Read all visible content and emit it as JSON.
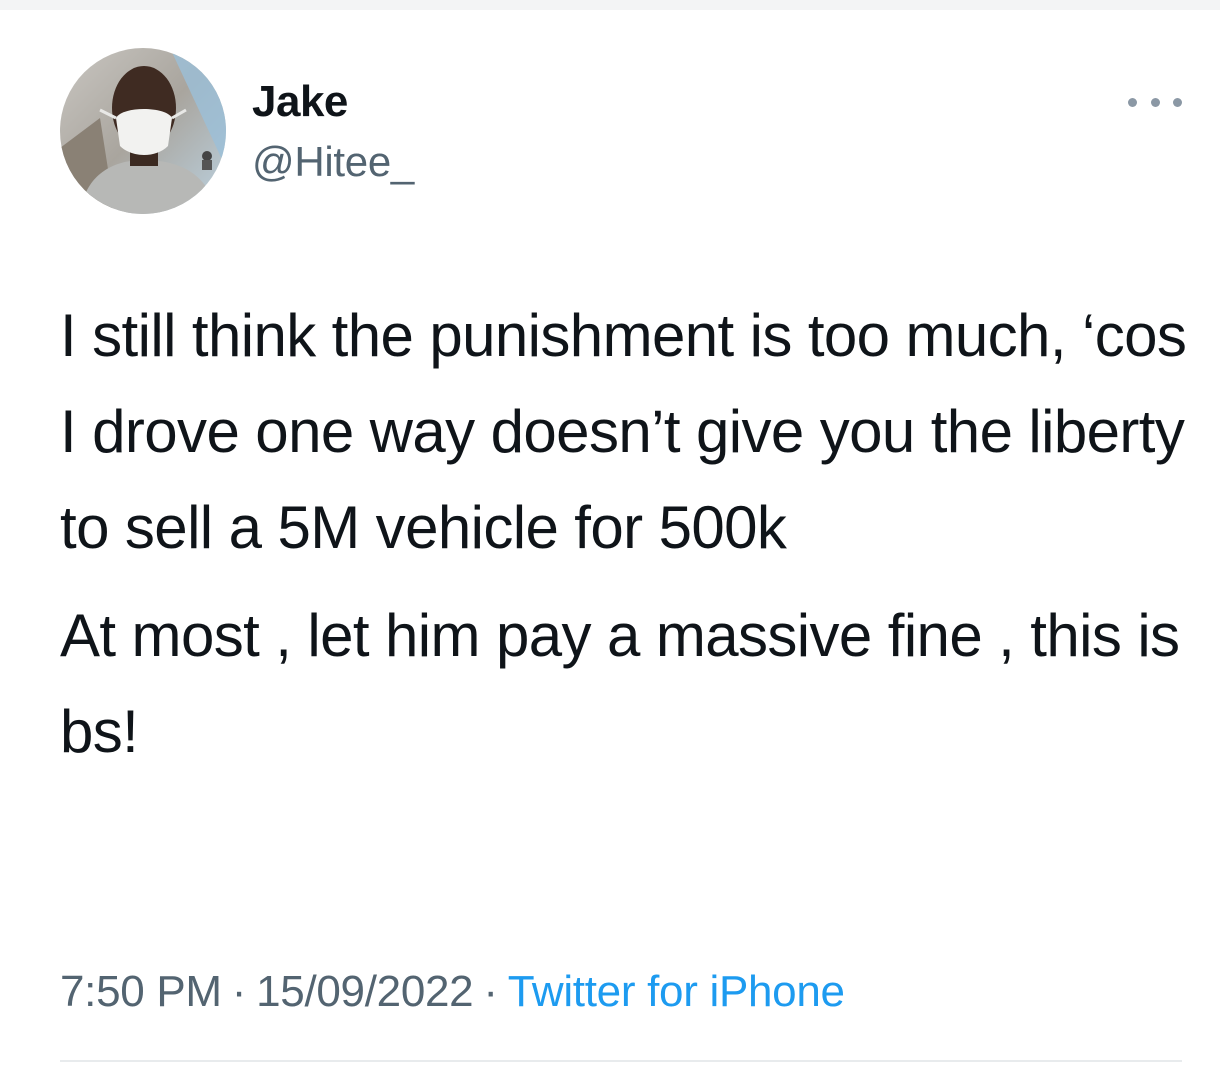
{
  "author": {
    "name": "Jake",
    "handle": "@Hitee_"
  },
  "tweet": {
    "paragraphs": [
      "I still think the punishment is too much, ‘cos I drove one way doesn’t give you the liberty to sell a 5M vehicle for 500k",
      "At most , let him pay a massive fine , this is bs!"
    ]
  },
  "meta": {
    "time": "7:50 PM",
    "separator": "·",
    "date": "15/09/2022",
    "source": "Twitter for iPhone"
  },
  "icons": {
    "more": "more-options-icon",
    "avatar": "profile-photo"
  },
  "colors": {
    "text": "#0f1419",
    "secondary": "#536471",
    "link": "#1d9bf0"
  }
}
